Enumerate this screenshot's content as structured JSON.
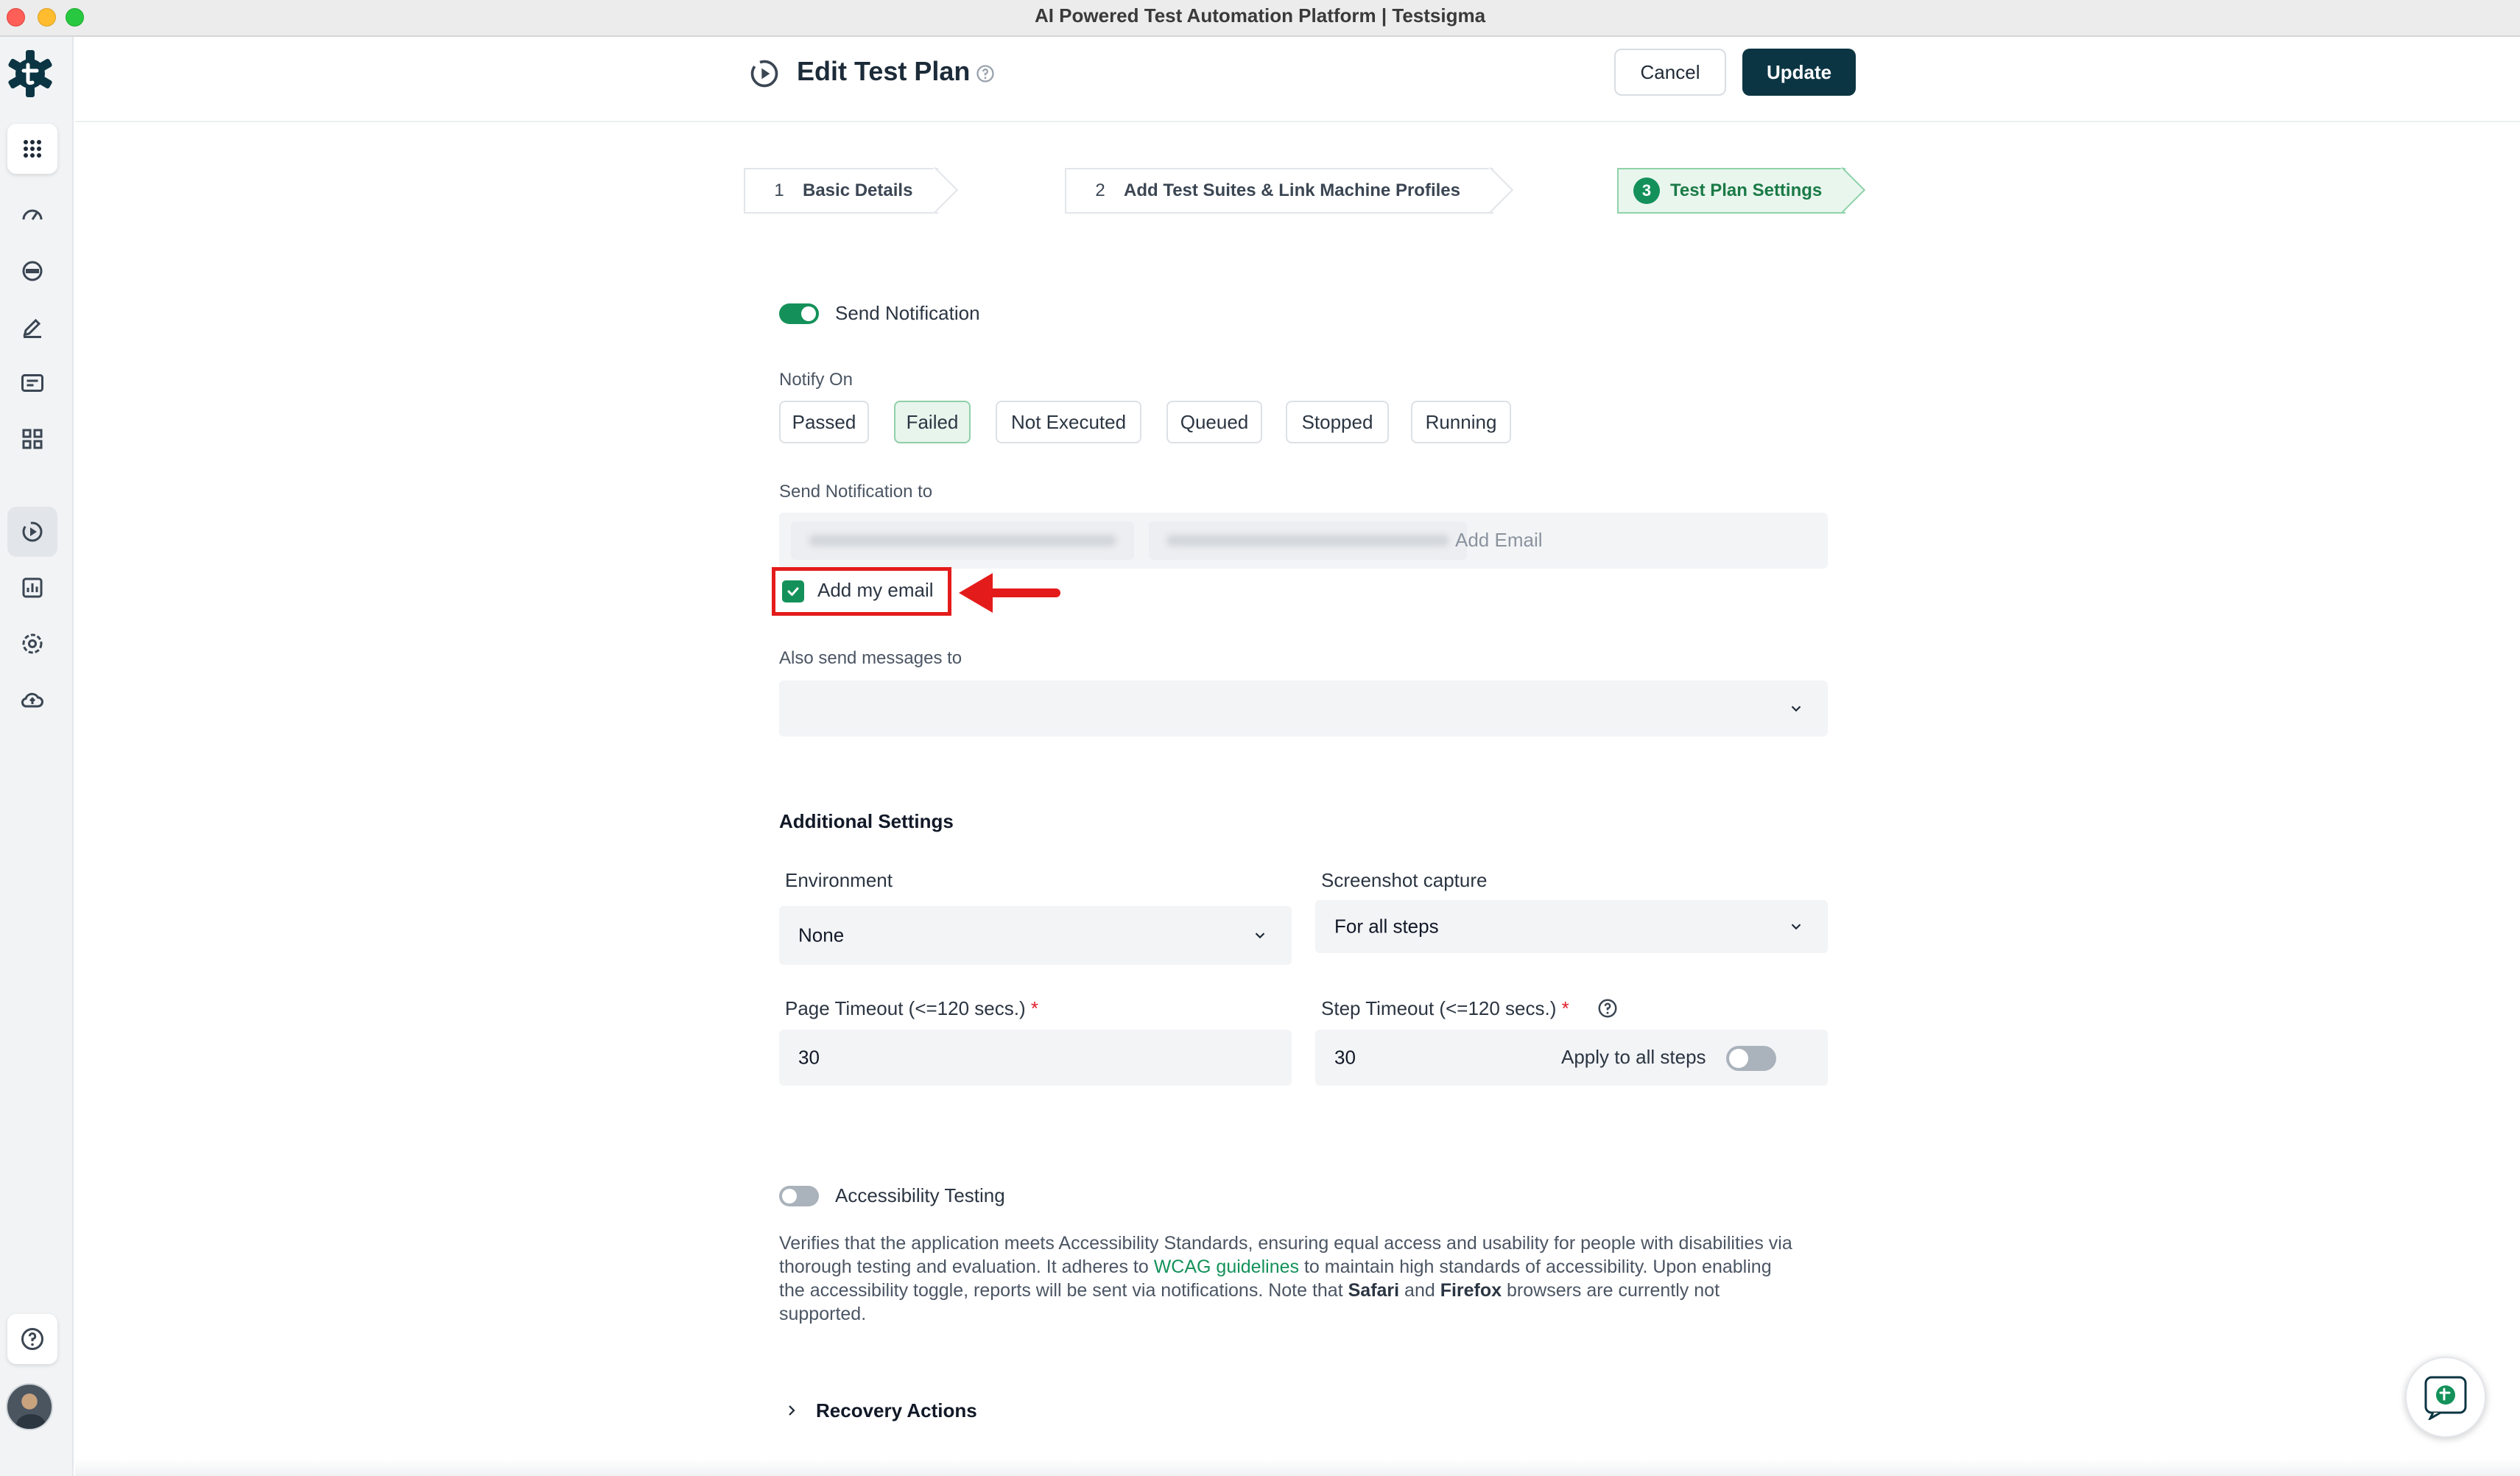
{
  "window": {
    "title": "AI Powered Test Automation Platform | Testsigma"
  },
  "header": {
    "title": "Edit Test Plan",
    "cancel_label": "Cancel",
    "update_label": "Update"
  },
  "stepper": [
    {
      "num": "1",
      "label": "Basic Details"
    },
    {
      "num": "2",
      "label": "Add Test Suites & Link Machine Profiles"
    },
    {
      "num": "3",
      "label": "Test Plan Settings"
    }
  ],
  "notification": {
    "send_label": "Send Notification",
    "send_enabled": true,
    "notify_on_label": "Notify On",
    "notify_options": [
      "Passed",
      "Failed",
      "Not Executed",
      "Queued",
      "Stopped",
      "Running"
    ],
    "selected_option": "Failed",
    "send_to_label": "Send Notification to",
    "add_email_placeholder": "Add Email",
    "add_my_email_label": "Add my email",
    "add_my_email_checked": true,
    "also_send_label": "Also send messages to",
    "also_send_value": ""
  },
  "additional": {
    "title": "Additional Settings",
    "environment_label": "Environment",
    "environment_value": "None",
    "screenshot_label": "Screenshot capture",
    "screenshot_value": "For all steps",
    "page_timeout_label": "Page Timeout (<=120 secs.)",
    "page_timeout_value": "30",
    "step_timeout_label": "Step Timeout (<=120 secs.)",
    "step_timeout_value": "30",
    "apply_all_label": "Apply to all steps",
    "apply_all_enabled": false,
    "required_mark": "*"
  },
  "accessibility": {
    "label": "Accessibility Testing",
    "enabled": false,
    "desc_1": "Verifies that the application meets Accessibility Standards, ensuring equal access and usability for people with disabilities via thorough testing and evaluation. It adheres to ",
    "desc_link": "WCAG guidelines",
    "desc_2": " to maintain high standards of accessibility. Upon enabling the accessibility toggle, reports will be sent via notifications. Note that ",
    "desc_safari": "Safari",
    "desc_and": " and ",
    "desc_firefox": "Firefox",
    "desc_3": " browsers are currently not supported."
  },
  "recovery": {
    "label": "Recovery Actions"
  },
  "colors": {
    "brand": "#0c3543",
    "accent": "#14915a",
    "highlight": "#e41b1b"
  },
  "rail_icons": [
    "app-grid-icon",
    "dashboard-icon",
    "agent-icon",
    "edit-icon",
    "folder-icon",
    "blocks-icon",
    "test-plan-icon",
    "reports-icon",
    "settings-icon",
    "cloud-icon",
    "help-icon"
  ]
}
